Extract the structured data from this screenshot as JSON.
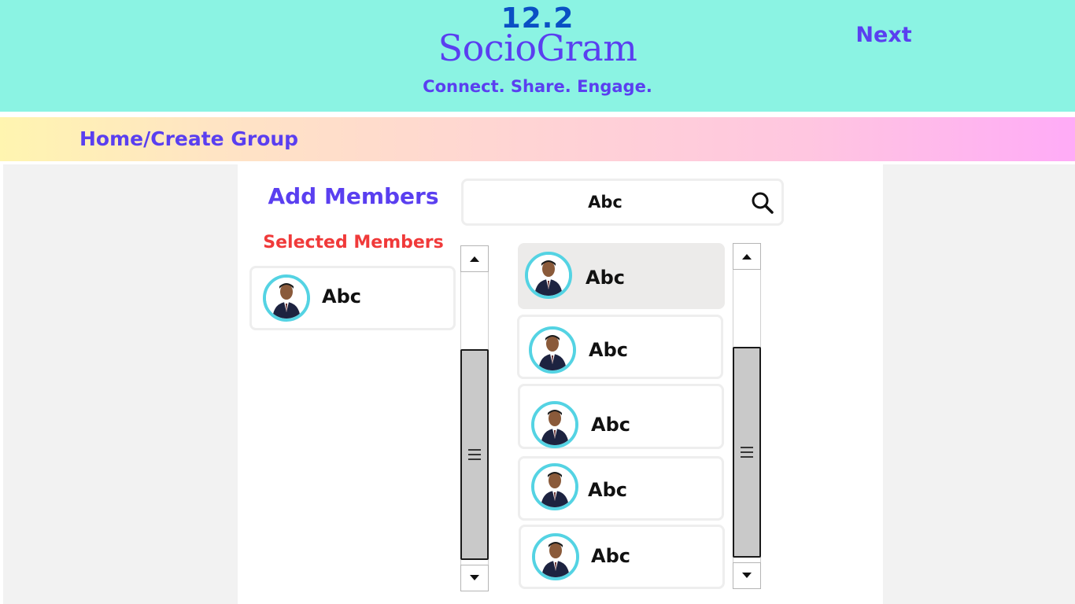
{
  "header": {
    "version": "12.2",
    "brand": "SocioGram",
    "tagline": "Connect. Share. Engage.",
    "next_label": "Next"
  },
  "breadcrumb": "Home/Create Group",
  "add_members_title": "Add Members",
  "selected_members_title": "Selected Members",
  "selected_members": [
    {
      "name": "Abc",
      "avatar": "user-avatar"
    }
  ],
  "search": {
    "value": "Abc",
    "icon": "search-icon"
  },
  "results": [
    {
      "name": "Abc",
      "highlighted": true
    },
    {
      "name": "Abc",
      "highlighted": false
    },
    {
      "name": "Abc",
      "highlighted": false
    },
    {
      "name": "Abc",
      "highlighted": false
    },
    {
      "name": "Abc",
      "highlighted": false
    }
  ],
  "colors": {
    "header_bg": "#8bf3e3",
    "accent": "#5a3ff0",
    "version": "#0a4fc4",
    "selected_title": "#f03a3a",
    "avatar_ring": "#54d3e3",
    "panel_bg": "#f2f2f2"
  }
}
